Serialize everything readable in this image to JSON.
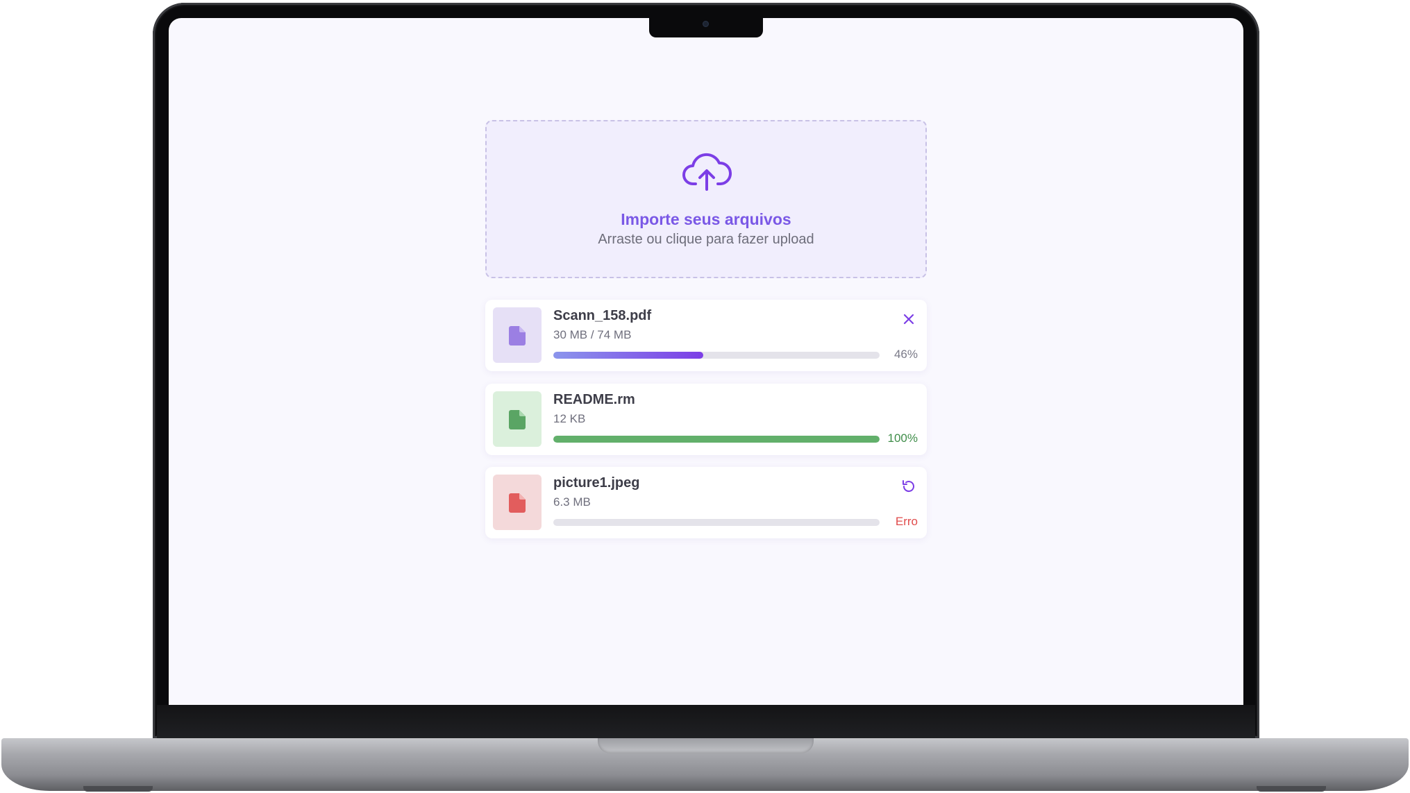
{
  "colors": {
    "accent": "#7a58e6",
    "success": "#5aa564",
    "error": "#e25d5d"
  },
  "upload": {
    "icon": "cloud-upload-icon",
    "title": "Importe seus arquivos",
    "subtitle": "Arraste ou clique para fazer upload"
  },
  "files": [
    {
      "name": "Scann_158.pdf",
      "size": "30 MB / 74 MB",
      "progress": 0.46,
      "status": "46%",
      "state": "uploading",
      "action_icon": "close-icon",
      "thumb_color": "#e6e0f6",
      "icon_color": "#9b7fe3",
      "fill_color": "linear-gradient(90deg, #8b95ec 0%, #7c3ee6 100%)",
      "status_color": "#7a7a88"
    },
    {
      "name": "README.rm",
      "size": "12 KB",
      "progress": 1.0,
      "status": "100%",
      "state": "complete",
      "action_icon": "",
      "thumb_color": "#dbf0dc",
      "icon_color": "#5aa564",
      "fill_color": "#62b06b",
      "status_color": "#3f8d49"
    },
    {
      "name": "picture1.jpeg",
      "size": "6.3 MB",
      "progress": 0,
      "status": "Erro",
      "state": "error",
      "action_icon": "retry-icon",
      "thumb_color": "#f4d9da",
      "icon_color": "#e25d5d",
      "fill_color": "#e4e3ea",
      "status_color": "#e04b4b"
    }
  ]
}
